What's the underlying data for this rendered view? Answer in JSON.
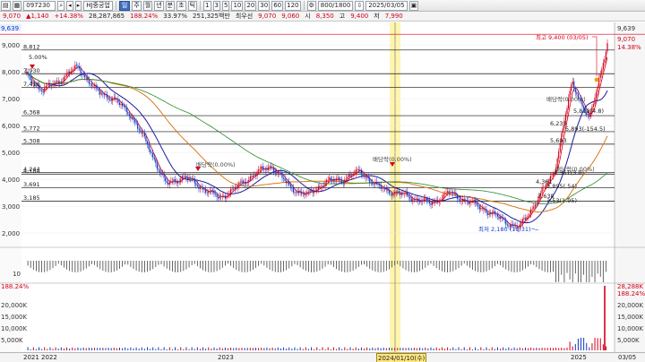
{
  "toolbar": {
    "code_value": "097230",
    "market_label": "HJ중공업",
    "period_buttons": [
      "주",
      "월",
      "년",
      "분",
      "초",
      "틱"
    ],
    "minute_buttons": [
      "1",
      "3",
      "5",
      "10",
      "20",
      "30",
      "60",
      "120"
    ],
    "count_value": "800/1800",
    "date_value": "2025/03/05"
  },
  "info": {
    "price": "9,070",
    "change": "1,140",
    "change_rate": "+14.38%",
    "volume": "28,287,865",
    "vol_ratio": "188.24%",
    "turnover_rate": "33.97%",
    "amount": "251,325백만",
    "preferred_label": "최우선",
    "ask": "9,070",
    "bid": "9,060",
    "open_label": "시",
    "open": "8,350",
    "high_label": "고",
    "high": "9,400",
    "low_label": "저",
    "low": "7,990"
  },
  "price_axis": {
    "ticks": [
      "9,000",
      "8,000",
      "7,000",
      "6,000",
      "5,000",
      "4,000",
      "3,000",
      "2,000"
    ],
    "right_top_labels": [
      "9,639",
      "9,070",
      "14.38%"
    ],
    "left_top_label": "9,639"
  },
  "level_labels": [
    "8,812",
    "7,930",
    "7,416",
    "6,368",
    "5,772",
    "5,308",
    "4,244",
    "4,184",
    "3,691",
    "3,185"
  ],
  "annotations": {
    "high_note": "최고 9,400 (03/05)",
    "low_note": "최저 2,180 (10/31)",
    "dividend_labels": [
      "배당락(0.00%)",
      "배당락(0.00%)",
      "배당락(0.00%)",
      "배당락(0.00%)"
    ],
    "left_top_pct": "5.00%",
    "cluster_labels": [
      "5,818(4.8)",
      "5,893(-154.5)",
      "6,233",
      "5,693",
      "4,361(3.8)",
      "4,361",
      "3,895(.54)",
      "3,638",
      "3,53(1.95)"
    ]
  },
  "volume_axis": {
    "ticks": [
      "20,000K",
      "15,000K",
      "10,000K",
      "5,000K"
    ],
    "small_tick": "10",
    "left_label": "188.24%",
    "right_labels": [
      "28,288K",
      "188.24%"
    ]
  },
  "xaxis": {
    "labels": [
      "2021",
      "2022",
      "2023",
      "2024/01/10(수)",
      "2025",
      "03/05"
    ]
  },
  "colors": {
    "up": "#d4001a",
    "down": "#1238c6",
    "ma5": "#d4001a",
    "ma20": "#1a1a9e",
    "ma60": "#d87a1a",
    "ma120": "#2a8a2a",
    "highlight": "#fff3a0"
  },
  "chart_data": {
    "type": "line",
    "title": "",
    "y_range": [
      1500,
      9640
    ],
    "x": [
      "2021",
      "2022",
      "2023",
      "2024",
      "2025",
      "03/05"
    ],
    "series": [
      {
        "name": "",
        "values": [
          7900,
          7300,
          7700,
          8200,
          7300,
          7000,
          6400,
          5200,
          3800,
          4100,
          3700,
          3300,
          3700,
          4200,
          4500,
          3700,
          3400,
          3900,
          4000,
          4300,
          3700,
          3500,
          3300,
          3100,
          3500,
          3200,
          2900,
          2500,
          2180,
          3200,
          4300,
          7600,
          6200,
          9070
        ]
      }
    ]
  }
}
